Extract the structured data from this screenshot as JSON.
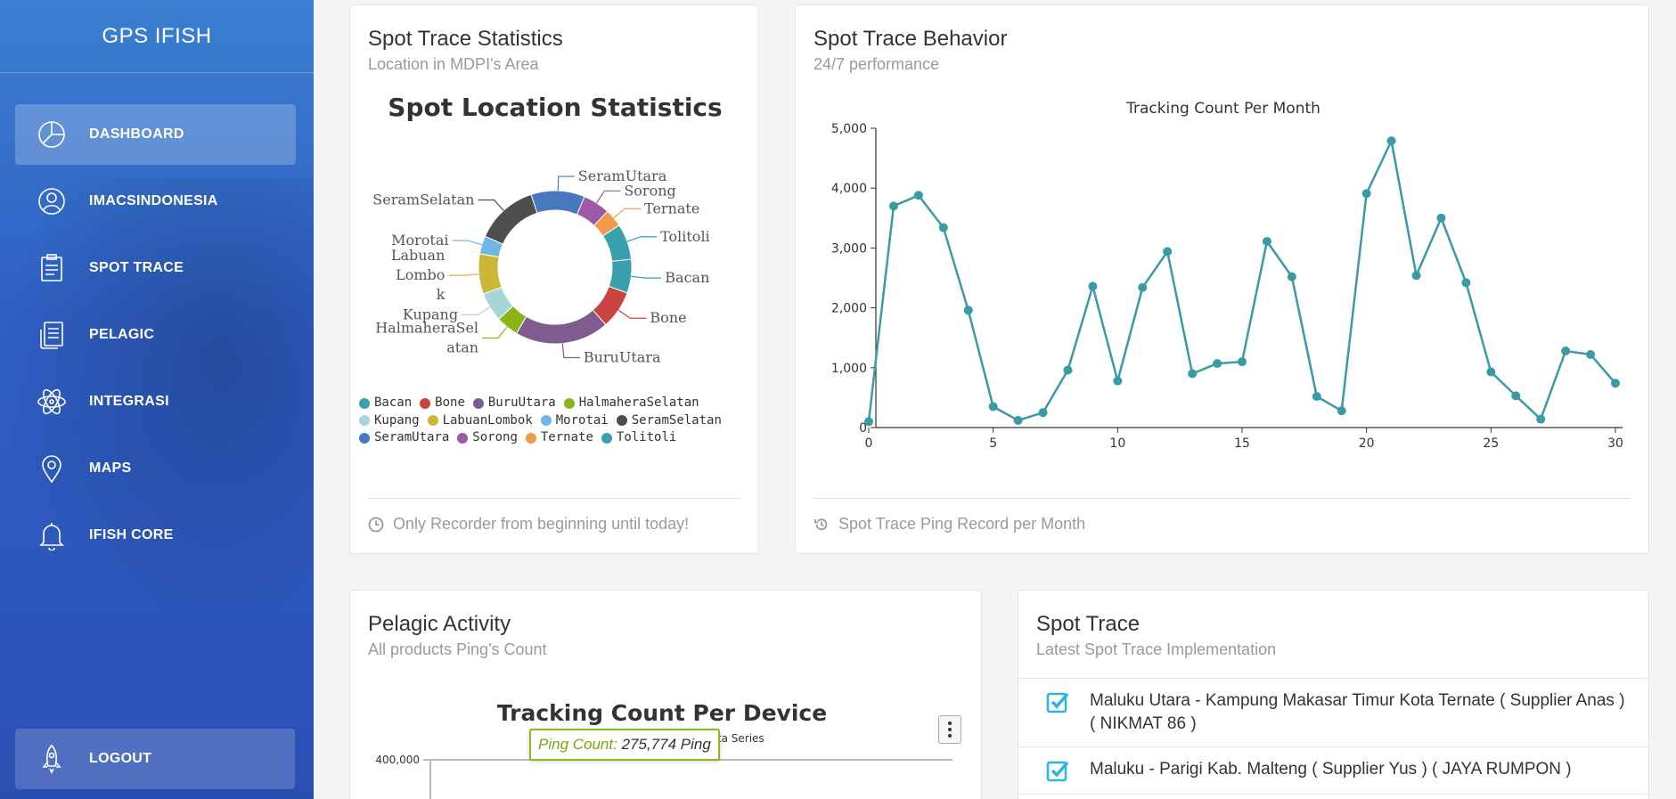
{
  "app": {
    "brand": "GPS IFISH"
  },
  "sidebar": {
    "items": [
      {
        "label": "DASHBOARD",
        "icon": "pie-chart-icon",
        "active": true
      },
      {
        "label": "IMACSINDONESIA",
        "icon": "user-icon",
        "active": false
      },
      {
        "label": "SPOT TRACE",
        "icon": "clipboard-icon",
        "active": false
      },
      {
        "label": "PELAGIC",
        "icon": "document-icon",
        "active": false
      },
      {
        "label": "INTEGRASI",
        "icon": "atom-icon",
        "active": false
      },
      {
        "label": "MAPS",
        "icon": "map-pin-icon",
        "active": false
      },
      {
        "label": "IFISH CORE",
        "icon": "bell-icon",
        "active": false
      }
    ],
    "logout": {
      "label": "LOGOUT",
      "icon": "rocket-icon"
    }
  },
  "stats_card": {
    "title": "Spot Trace Statistics",
    "subtitle": "Location in MDPI's Area",
    "footer": "Only Recorder from beginning until today!",
    "footer_icon": "clock-icon"
  },
  "behavior_card": {
    "title": "Spot Trace Behavior",
    "subtitle": "24/7 performance",
    "footer": "Spot Trace Ping Record per Month",
    "footer_icon": "history-icon"
  },
  "pelagic_card": {
    "title": "Pelagic Activity",
    "subtitle": "All products Ping's Count",
    "tooltip_label": "Ping Count:",
    "tooltip_value": "275,774 Ping"
  },
  "spot_card": {
    "title": "Spot Trace",
    "subtitle": "Latest Spot Trace Implementation",
    "rows": [
      "Maluku Utara - Kampung Makasar Timur Kota Ternate ( Supplier Anas ) ( NIKMAT 86 )",
      "Maluku - Parigi Kab. Malteng ( Supplier Yus ) ( JAYA RUMPON )"
    ]
  },
  "chart_data": [
    {
      "type": "pie",
      "title": "Spot Location Statistics",
      "donut": true,
      "legend_position": "bottom",
      "categories": [
        "Bacan",
        "Bone",
        "BuruUtara",
        "HalmaheraSelatan",
        "Kupang",
        "LabuanLombok",
        "Morotai",
        "SeramSelatan",
        "SeramUtara",
        "Sorong",
        "Ternate",
        "Tolitoli"
      ],
      "slice_labels": [
        "Bacan",
        "Bone",
        "BuruUtara",
        "HalmaheraSel atan",
        "Kupang",
        "Labuan Lombo k",
        "Morotai",
        "SeramSelatan",
        "SeramUtara",
        "Sorong",
        "Ternate",
        "Tolitoli"
      ],
      "values": [
        7.5,
        8.5,
        21,
        5,
        6.5,
        9,
        4,
        14,
        12,
        6,
        4,
        8
      ],
      "colors": [
        "#3aa0ad",
        "#c9443e",
        "#7e5c8f",
        "#8ab519",
        "#a8d6d8",
        "#cbb637",
        "#6fb7e6",
        "#4e4e4e",
        "#4a78bf",
        "#9b59a6",
        "#f39a4a",
        "#3aa0ad"
      ]
    },
    {
      "type": "line",
      "title": "Tracking Count Per Month",
      "xlabel": "",
      "ylabel": "",
      "x": [
        0,
        1,
        2,
        3,
        4,
        5,
        6,
        7,
        8,
        9,
        10,
        11,
        12,
        13,
        14,
        15,
        16,
        17,
        18,
        19,
        20,
        21,
        22,
        23,
        24,
        25,
        26,
        27,
        28,
        29,
        30
      ],
      "values": [
        100,
        3700,
        3880,
        3340,
        1960,
        350,
        120,
        250,
        960,
        2360,
        780,
        2340,
        2940,
        900,
        1070,
        1100,
        3110,
        2520,
        520,
        280,
        3910,
        4790,
        2540,
        3500,
        2420,
        930,
        530,
        140,
        1280,
        1220,
        740
      ],
      "xlim": [
        0,
        30
      ],
      "ylim": [
        0,
        5000
      ],
      "xticks": [
        "0",
        "5",
        "10",
        "15",
        "20",
        "25",
        "30"
      ],
      "yticks": [
        "0",
        "1,000",
        "2,000",
        "3,000",
        "4,000",
        "5,000"
      ],
      "color": "#3a9aa5",
      "grid": false
    },
    {
      "type": "bar",
      "title": "Tracking Count Per Device",
      "subtitle": "Data Series",
      "yticks": [
        "400,000"
      ],
      "ylim": [
        0,
        400000
      ]
    }
  ]
}
